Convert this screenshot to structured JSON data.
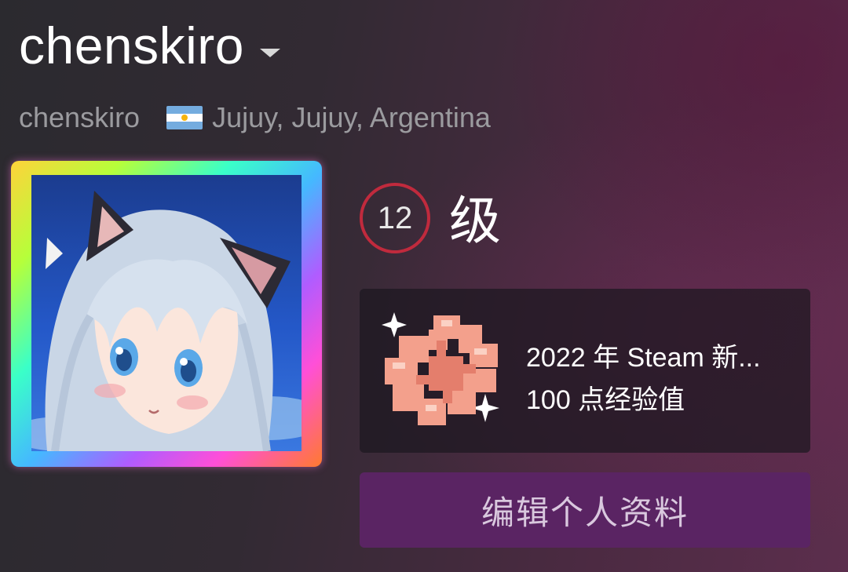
{
  "profile": {
    "display_name": "chenskiro",
    "account_name": "chenskiro",
    "location": "Jujuy, Jujuy, Argentina",
    "flag_icon": "argentina-flag-icon"
  },
  "level": {
    "number": "12",
    "label": "级",
    "ring_color": "#c02a3d"
  },
  "badge": {
    "title": "2022 年 Steam 新...",
    "xp": "100 点经验值",
    "icon": "badge-icon"
  },
  "actions": {
    "edit_profile_label": "编辑个人资料"
  },
  "colors": {
    "accent_button": "#5a2463",
    "level_ring": "#c02a3d"
  }
}
